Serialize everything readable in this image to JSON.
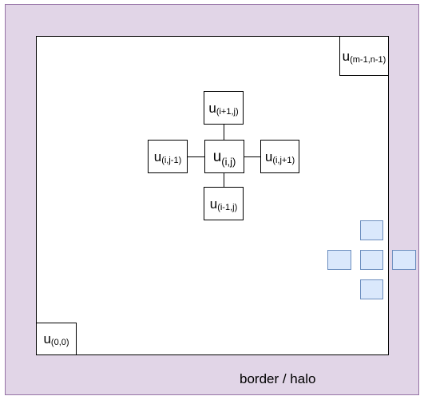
{
  "colors": {
    "halo_fill": "#e1d5e7",
    "halo_stroke": "#9673a6",
    "ghost_fill": "#dae8fc",
    "ghost_stroke": "#6c8ebf"
  },
  "halo_label": "border / halo",
  "cells": {
    "corner_top_right": {
      "base": "u",
      "sub": "(m-1,n-1)"
    },
    "corner_bottom_left": {
      "base": "u",
      "sub": "(0,0)"
    },
    "north": {
      "base": "u",
      "sub": "(i+1,j)"
    },
    "west": {
      "base": "u",
      "sub": "(i,j-1)"
    },
    "center": {
      "base": "u",
      "sub": "(i,j)"
    },
    "east": {
      "base": "u",
      "sub": "(i,j+1)"
    },
    "south": {
      "base": "u",
      "sub": "(i-1,j)"
    }
  }
}
